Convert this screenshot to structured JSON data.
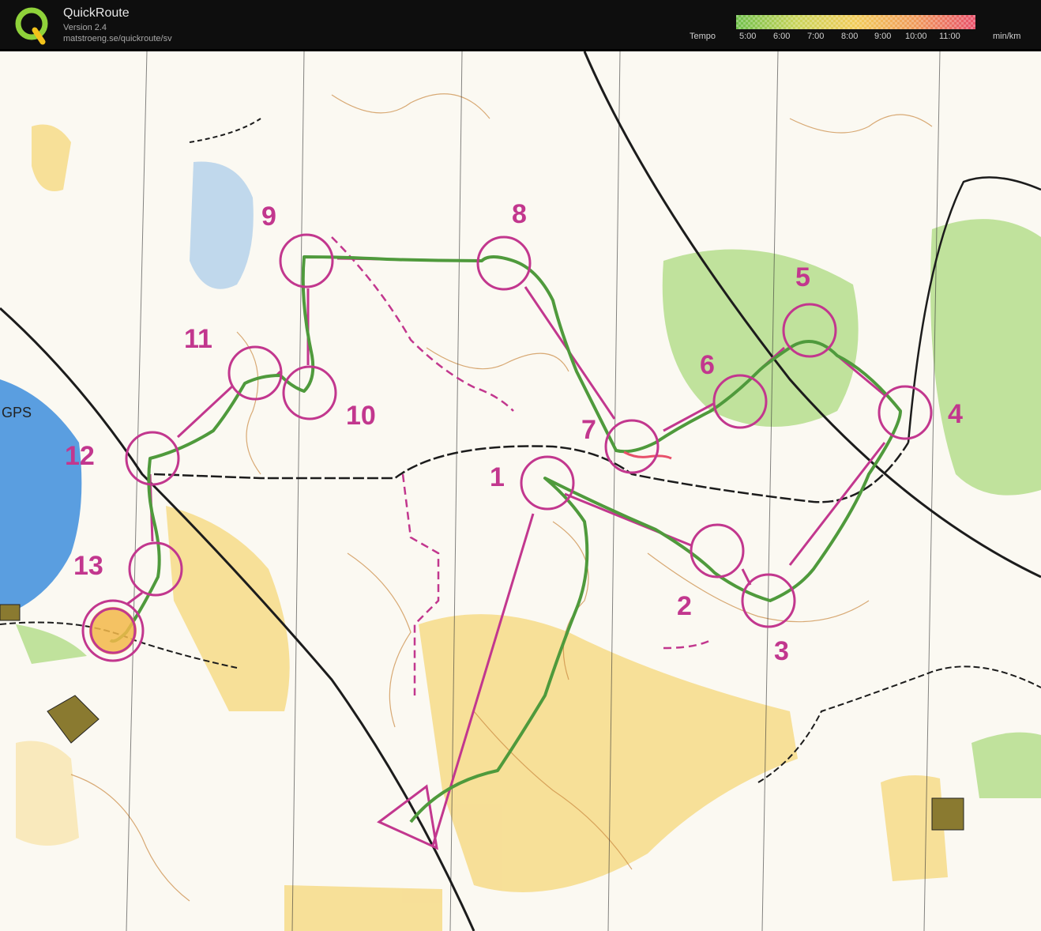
{
  "app": {
    "title": "QuickRoute",
    "version": "Version 2.4",
    "url": "matstroeng.se/quickroute/sv",
    "logo_icon": "quickroute-q-logo-icon"
  },
  "legend": {
    "label": "Tempo",
    "ticks": [
      "5:00",
      "6:00",
      "7:00",
      "8:00",
      "9:00",
      "10:00",
      "11:00"
    ],
    "unit": "min/km",
    "gradient_colors": [
      "#6fbf4a",
      "#c9d45a",
      "#f2cc5a",
      "#f09a5a",
      "#e8506a"
    ]
  },
  "map": {
    "course_color": "#c2378e",
    "route_color": "#4f9a3c",
    "gps_label": "GPS",
    "controls": [
      {
        "label": "1"
      },
      {
        "label": "2"
      },
      {
        "label": "3"
      },
      {
        "label": "4"
      },
      {
        "label": "5"
      },
      {
        "label": "6"
      },
      {
        "label": "7"
      },
      {
        "label": "8"
      },
      {
        "label": "9"
      },
      {
        "label": "10"
      },
      {
        "label": "11"
      },
      {
        "label": "12"
      },
      {
        "label": "13"
      }
    ]
  }
}
